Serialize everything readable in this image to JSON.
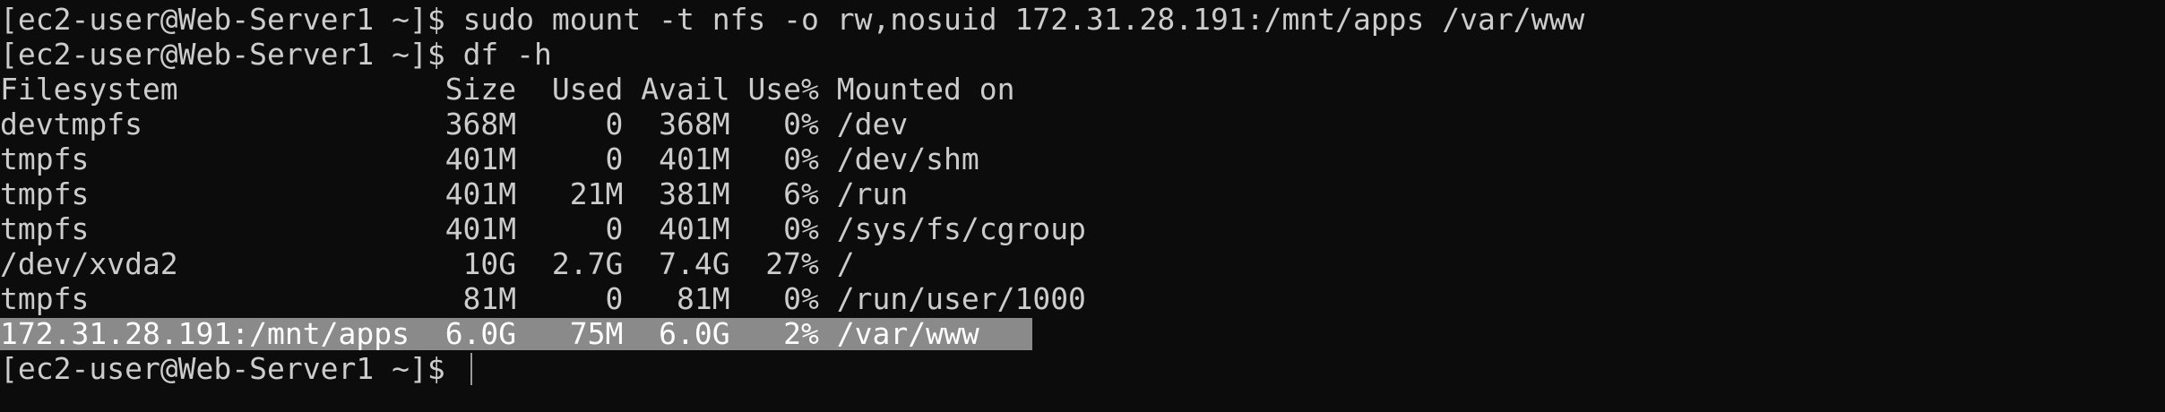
{
  "terminal": {
    "prompt": "[ec2-user@Web-Server1 ~]$ ",
    "commands": [
      "sudo mount -t nfs -o rw,nosuid 172.31.28.191:/mnt/apps /var/www",
      "df -h"
    ],
    "df_header": "Filesystem               Size  Used Avail Use% Mounted on",
    "df_rows": [
      "devtmpfs                 368M     0  368M   0% /dev",
      "tmpfs                    401M     0  401M   0% /dev/shm",
      "tmpfs                    401M   21M  381M   6% /run",
      "tmpfs                    401M     0  401M   0% /sys/fs/cgroup",
      "/dev/xvda2                10G  2.7G  7.4G  27% /",
      "tmpfs                     81M     0   81M   0% /run/user/1000",
      "172.31.28.191:/mnt/apps  6.0G   75M  6.0G   2% /var/www   "
    ],
    "final_prompt": "[ec2-user@Web-Server1 ~]$ "
  },
  "colors": {
    "background": "#0c0c0c",
    "foreground": "#cccccc",
    "selection": "#8a8a8a"
  }
}
